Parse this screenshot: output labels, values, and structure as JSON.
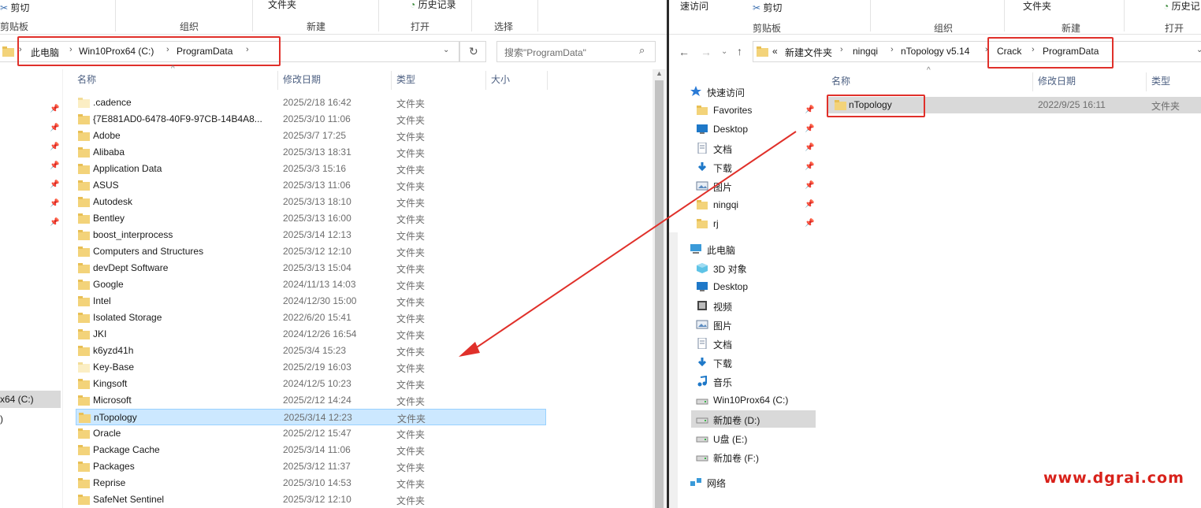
{
  "left_window": {
    "ribbon": {
      "cut": "剪切",
      "clipboard_group": "剪贴板",
      "organize_group": "组织",
      "new_folder": "文件夹",
      "new_group": "新建",
      "history": "历史记录",
      "open_group": "打开",
      "select_group": "选择"
    },
    "breadcrumb": [
      "此电脑",
      "Win10Prox64 (C:)",
      "ProgramData"
    ],
    "search_placeholder": "搜索\"ProgramData\"",
    "columns": {
      "name": "名称",
      "date": "修改日期",
      "type": "类型",
      "size": "大小"
    },
    "nav_partial": {
      "drive_c": "x64 (C:)",
      "drive_d": ")"
    },
    "files": [
      {
        "name": ".cadence",
        "date": "2025/2/18 16:42",
        "type": "文件夹"
      },
      {
        "name": "{7E881AD0-6478-40F9-97CB-14B4A8...",
        "date": "2025/3/10 11:06",
        "type": "文件夹"
      },
      {
        "name": "Adobe",
        "date": "2025/3/7 17:25",
        "type": "文件夹"
      },
      {
        "name": "Alibaba",
        "date": "2025/3/13 18:31",
        "type": "文件夹"
      },
      {
        "name": "Application Data",
        "date": "2025/3/3 15:16",
        "type": "文件夹"
      },
      {
        "name": "ASUS",
        "date": "2025/3/13 11:06",
        "type": "文件夹"
      },
      {
        "name": "Autodesk",
        "date": "2025/3/13 18:10",
        "type": "文件夹"
      },
      {
        "name": "Bentley",
        "date": "2025/3/13 16:00",
        "type": "文件夹"
      },
      {
        "name": "boost_interprocess",
        "date": "2025/3/14 12:13",
        "type": "文件夹"
      },
      {
        "name": "Computers and Structures",
        "date": "2025/3/12 12:10",
        "type": "文件夹"
      },
      {
        "name": "devDept Software",
        "date": "2025/3/13 15:04",
        "type": "文件夹"
      },
      {
        "name": "Google",
        "date": "2024/11/13 14:03",
        "type": "文件夹"
      },
      {
        "name": "Intel",
        "date": "2024/12/30 15:00",
        "type": "文件夹"
      },
      {
        "name": "Isolated Storage",
        "date": "2022/6/20 15:41",
        "type": "文件夹"
      },
      {
        "name": "JKI",
        "date": "2024/12/26 16:54",
        "type": "文件夹"
      },
      {
        "name": "k6yzd41h",
        "date": "2025/3/4 15:23",
        "type": "文件夹"
      },
      {
        "name": "Key-Base",
        "date": "2025/2/19 16:03",
        "type": "文件夹"
      },
      {
        "name": "Kingsoft",
        "date": "2024/12/5 10:23",
        "type": "文件夹"
      },
      {
        "name": "Microsoft",
        "date": "2025/2/12 14:24",
        "type": "文件夹"
      },
      {
        "name": "nTopology",
        "date": "2025/3/14 12:23",
        "type": "文件夹"
      },
      {
        "name": "Oracle",
        "date": "2025/2/12 15:47",
        "type": "文件夹"
      },
      {
        "name": "Package Cache",
        "date": "2025/3/14 11:06",
        "type": "文件夹"
      },
      {
        "name": "Packages",
        "date": "2025/3/12 11:37",
        "type": "文件夹"
      },
      {
        "name": "Reprise",
        "date": "2025/3/10 14:53",
        "type": "文件夹"
      },
      {
        "name": "SafeNet Sentinel",
        "date": "2025/3/12 12:10",
        "type": "文件夹"
      }
    ]
  },
  "right_window": {
    "ribbon": {
      "quick": "速访问",
      "cut": "剪切",
      "clipboard_group": "剪贴板",
      "organize_group": "组织",
      "new_folder": "文件夹",
      "new_group": "新建",
      "history": "历史记",
      "open_group": "打开"
    },
    "breadcrumb_prefix": "«",
    "breadcrumb": [
      "新建文件夹",
      "ningqi",
      "nTopology v5.14",
      "Crack",
      "ProgramData"
    ],
    "columns": {
      "name": "名称",
      "date": "修改日期",
      "type": "类型"
    },
    "files": [
      {
        "name": "nTopology",
        "date": "2022/9/25 16:11",
        "type": "文件夹"
      }
    ],
    "nav": {
      "quick_access": "快速访问",
      "quick_items": [
        "Favorites",
        "Desktop",
        "文档",
        "下载",
        "图片",
        "ningqi",
        "rj"
      ],
      "this_pc": "此电脑",
      "pc_items": [
        "3D 对象",
        "Desktop",
        "视频",
        "图片",
        "文档",
        "下载",
        "音乐",
        "Win10Prox64 (C:)",
        "新加卷 (D:)",
        "U盘 (E:)",
        "新加卷 (F:)"
      ],
      "network": "网络"
    }
  },
  "watermark": "www.dgrai.com",
  "colors": {
    "annotation_red": "#e0302a",
    "selection_blue": "#cce8ff",
    "folder_yellow": "#f3d37a"
  }
}
